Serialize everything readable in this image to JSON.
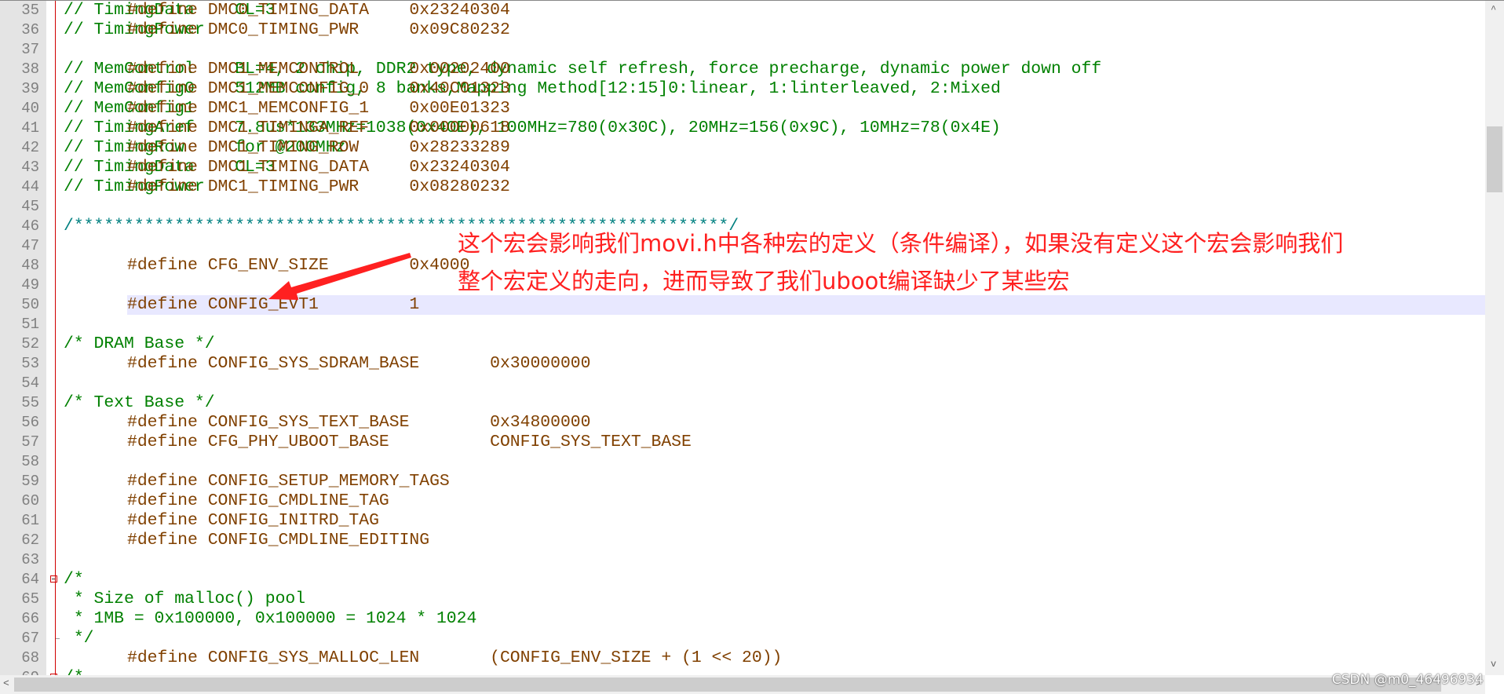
{
  "editor": {
    "highlighted_line": 50,
    "fold_open_lines": [
      64,
      69
    ],
    "fold_end_lines": [
      67
    ],
    "lines": [
      {
        "num": "35",
        "parts": [
          {
            "type": "code",
            "text": "#define DMC0_TIMING_DATA    0x23240304  "
          },
          {
            "type": "cmt",
            "text": "// TimingData    CL=3"
          }
        ]
      },
      {
        "num": "36",
        "parts": [
          {
            "type": "code",
            "text": "#define DMC0_TIMING_PWR     0x09C80232  "
          },
          {
            "type": "cmt",
            "text": "// TimingPower"
          }
        ]
      },
      {
        "num": "37",
        "parts": []
      },
      {
        "num": "38",
        "parts": [
          {
            "type": "code",
            "text": "#define DMC1_MEMCONTROL     0x00202400  "
          },
          {
            "type": "cmt",
            "text": "// MemControl    BL=4, 2 chip, DDR2 type, dynamic self refresh, force precharge, dynamic power down off"
          }
        ]
      },
      {
        "num": "39",
        "parts": [
          {
            "type": "code",
            "text": "#define DMC1_MEMCONFIG_0    0x40C01323  "
          },
          {
            "type": "cmt",
            "text": "// MemConfig0    512MB config, 8 banks,Mapping Method[12:15]0:linear, 1:linterleaved, 2:Mixed"
          }
        ]
      },
      {
        "num": "40",
        "parts": [
          {
            "type": "code",
            "text": "#define DMC1_MEMCONFIG_1    0x00E01323  "
          },
          {
            "type": "cmt",
            "text": "// MemConfig1"
          }
        ]
      },
      {
        "num": "41",
        "parts": [
          {
            "type": "code",
            "text": "#define DMC1_TIMINGA_REF    0x00000618  "
          },
          {
            "type": "cmt",
            "text": "// TimingAref    7.8us*133MHz=1038(0x40E), 100MHz=780(0x30C), 20MHz=156(0x9C), 10MHz=78(0x4E)"
          }
        ]
      },
      {
        "num": "42",
        "parts": [
          {
            "type": "code",
            "text": "#define DMC1_TIMING_ROW     0x28233289  "
          },
          {
            "type": "cmt",
            "text": "// TimingRow     for @200MHz"
          }
        ]
      },
      {
        "num": "43",
        "parts": [
          {
            "type": "code",
            "text": "#define DMC1_TIMING_DATA    0x23240304  "
          },
          {
            "type": "cmt",
            "text": "// TimingData    CL=3"
          }
        ]
      },
      {
        "num": "44",
        "parts": [
          {
            "type": "code",
            "text": "#define DMC1_TIMING_PWR     0x08280232  "
          },
          {
            "type": "cmt",
            "text": "// TimingPower"
          }
        ]
      },
      {
        "num": "45",
        "parts": []
      },
      {
        "num": "46",
        "parts": [
          {
            "type": "blk",
            "text": "/*****************************************************************/"
          }
        ]
      },
      {
        "num": "47",
        "parts": []
      },
      {
        "num": "48",
        "parts": [
          {
            "type": "code",
            "text": "#define CFG_ENV_SIZE        0x4000"
          }
        ]
      },
      {
        "num": "49",
        "parts": []
      },
      {
        "num": "50",
        "parts": [
          {
            "type": "code",
            "text": "#define CONFIG_EVT1         1"
          }
        ]
      },
      {
        "num": "51",
        "parts": []
      },
      {
        "num": "52",
        "parts": [
          {
            "type": "cmt",
            "text": "/* DRAM Base */"
          }
        ]
      },
      {
        "num": "53",
        "parts": [
          {
            "type": "code",
            "text": "#define CONFIG_SYS_SDRAM_BASE       0x30000000"
          }
        ]
      },
      {
        "num": "54",
        "parts": []
      },
      {
        "num": "55",
        "parts": [
          {
            "type": "cmt",
            "text": "/* Text Base */"
          }
        ]
      },
      {
        "num": "56",
        "parts": [
          {
            "type": "code",
            "text": "#define CONFIG_SYS_TEXT_BASE        0x34800000"
          }
        ]
      },
      {
        "num": "57",
        "parts": [
          {
            "type": "code",
            "text": "#define CFG_PHY_UBOOT_BASE          CONFIG_SYS_TEXT_BASE"
          }
        ]
      },
      {
        "num": "58",
        "parts": []
      },
      {
        "num": "59",
        "parts": [
          {
            "type": "code",
            "text": "#define CONFIG_SETUP_MEMORY_TAGS"
          }
        ]
      },
      {
        "num": "60",
        "parts": [
          {
            "type": "code",
            "text": "#define CONFIG_CMDLINE_TAG"
          }
        ]
      },
      {
        "num": "61",
        "parts": [
          {
            "type": "code",
            "text": "#define CONFIG_INITRD_TAG"
          }
        ]
      },
      {
        "num": "62",
        "parts": [
          {
            "type": "code",
            "text": "#define CONFIG_CMDLINE_EDITING"
          }
        ]
      },
      {
        "num": "63",
        "parts": []
      },
      {
        "num": "64",
        "parts": [
          {
            "type": "cmt",
            "text": "/*"
          }
        ]
      },
      {
        "num": "65",
        "parts": [
          {
            "type": "cmt",
            "text": " * Size of malloc() pool"
          }
        ]
      },
      {
        "num": "66",
        "parts": [
          {
            "type": "cmt",
            "text": " * 1MB = 0x100000, 0x100000 = 1024 * 1024"
          }
        ]
      },
      {
        "num": "67",
        "parts": [
          {
            "type": "cmt",
            "text": " */"
          }
        ]
      },
      {
        "num": "68",
        "parts": [
          {
            "type": "code",
            "text": "#define CONFIG_SYS_MALLOC_LEN       (CONFIG_ENV_SIZE + (1 << 20))"
          }
        ]
      },
      {
        "num": "69",
        "parts": [
          {
            "type": "cmt",
            "text": "/*"
          }
        ]
      }
    ]
  },
  "annotation": {
    "line1": "这个宏会影响我们movi.h中各种宏的定义（条件编译），如果没有定义这个宏会影响我们",
    "line2": "整个宏定义的走向，进而导致了我们uboot编译缺少了某些宏",
    "color": "#ff2020"
  },
  "scrollbars": {
    "up_arrow": "^",
    "down_arrow": "v",
    "left_arrow": "<",
    "right_arrow": ">"
  },
  "watermark": "CSDN @m0_46496934"
}
